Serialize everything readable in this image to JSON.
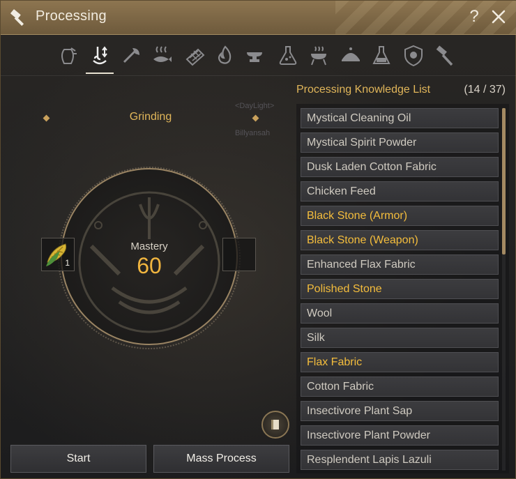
{
  "window": {
    "title": "Processing",
    "help_label": "?"
  },
  "toolbar": {
    "tabs": [
      {
        "icon": "shaking-icon"
      },
      {
        "icon": "grinding-icon",
        "active": true
      },
      {
        "icon": "chopping-icon"
      },
      {
        "icon": "drying-icon"
      },
      {
        "icon": "filtering-icon"
      },
      {
        "icon": "heating-icon"
      },
      {
        "icon": "anvil-icon"
      },
      {
        "icon": "alchemy-flask-icon"
      },
      {
        "icon": "grill-icon"
      },
      {
        "icon": "cooking-dish-icon"
      },
      {
        "icon": "alchemy-stone-icon"
      },
      {
        "icon": "guild-crest-icon"
      },
      {
        "icon": "hammer-icon"
      }
    ]
  },
  "left_panel": {
    "category": "Grinding",
    "mastery_label": "Mastery",
    "mastery_value": "60",
    "input_slot": {
      "item_icon": "corn-icon",
      "count": "1"
    },
    "output_slot": {
      "empty": true
    }
  },
  "buttons": {
    "start": "Start",
    "mass_process": "Mass Process"
  },
  "knowledge_list": {
    "header": "Processing Knowledge List",
    "count": "(14 / 37)",
    "highlight_color": "#f4bd3c",
    "items": [
      {
        "label": "Mystical Cleaning Oil",
        "highlighted": false
      },
      {
        "label": "Mystical Spirit Powder",
        "highlighted": false
      },
      {
        "label": "Dusk Laden Cotton Fabric",
        "highlighted": false
      },
      {
        "label": "Chicken Feed",
        "highlighted": false
      },
      {
        "label": "Black Stone (Armor)",
        "highlighted": true
      },
      {
        "label": "Black Stone (Weapon)",
        "highlighted": true
      },
      {
        "label": "Enhanced Flax Fabric",
        "highlighted": false
      },
      {
        "label": "Polished Stone",
        "highlighted": true
      },
      {
        "label": "Wool",
        "highlighted": false
      },
      {
        "label": "Silk",
        "highlighted": false
      },
      {
        "label": "Flax Fabric",
        "highlighted": true
      },
      {
        "label": "Cotton Fabric",
        "highlighted": false
      },
      {
        "label": "Insectivore Plant Sap",
        "highlighted": false
      },
      {
        "label": "Insectivore Plant Powder",
        "highlighted": false
      },
      {
        "label": "Resplendent Lapis Lazuli",
        "highlighted": false
      }
    ]
  },
  "background_text": {
    "daylight": "<DayLight>",
    "name": "Billyansah"
  }
}
